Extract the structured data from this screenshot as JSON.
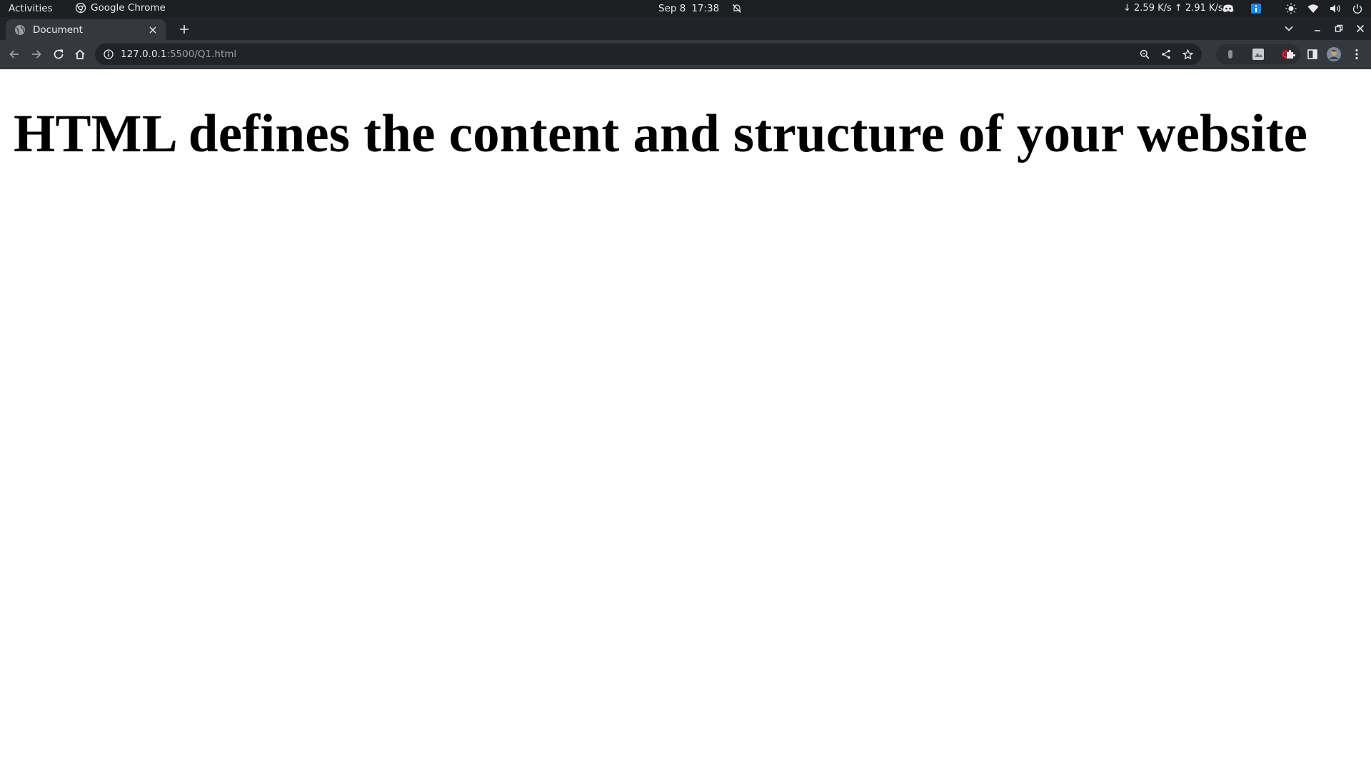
{
  "system_bar": {
    "activities": "Activities",
    "app_name": "Google Chrome",
    "date": "Sep 8",
    "time": "17:38",
    "network_speed": "↓ 2.59 K/s ↑ 2.91 K/s",
    "icons": [
      "chrome-icon",
      "notifications-off-icon",
      "discord-icon",
      "info-badge-icon",
      "brightness-icon",
      "wifi-icon",
      "volume-icon",
      "power-icon"
    ]
  },
  "browser": {
    "tab": {
      "title": "Document",
      "favicon": "globe-icon"
    },
    "omnibox": {
      "url_host": "127.0.0.1",
      "url_rest": ":5500/Q1.html"
    },
    "toolbar_icons": [
      "back-icon",
      "forward-icon",
      "reload-icon",
      "home-icon",
      "zoom-icon",
      "share-icon",
      "bookmark-star-icon",
      "extensions-puzzle-icon",
      "side-panel-icon",
      "profile-avatar",
      "menu-kebab-icon"
    ],
    "colors": {
      "frame": "#202327",
      "toolbar": "#35393f",
      "omnibox": "#202327"
    }
  },
  "page": {
    "heading": "HTML defines the content and structure of your website"
  }
}
